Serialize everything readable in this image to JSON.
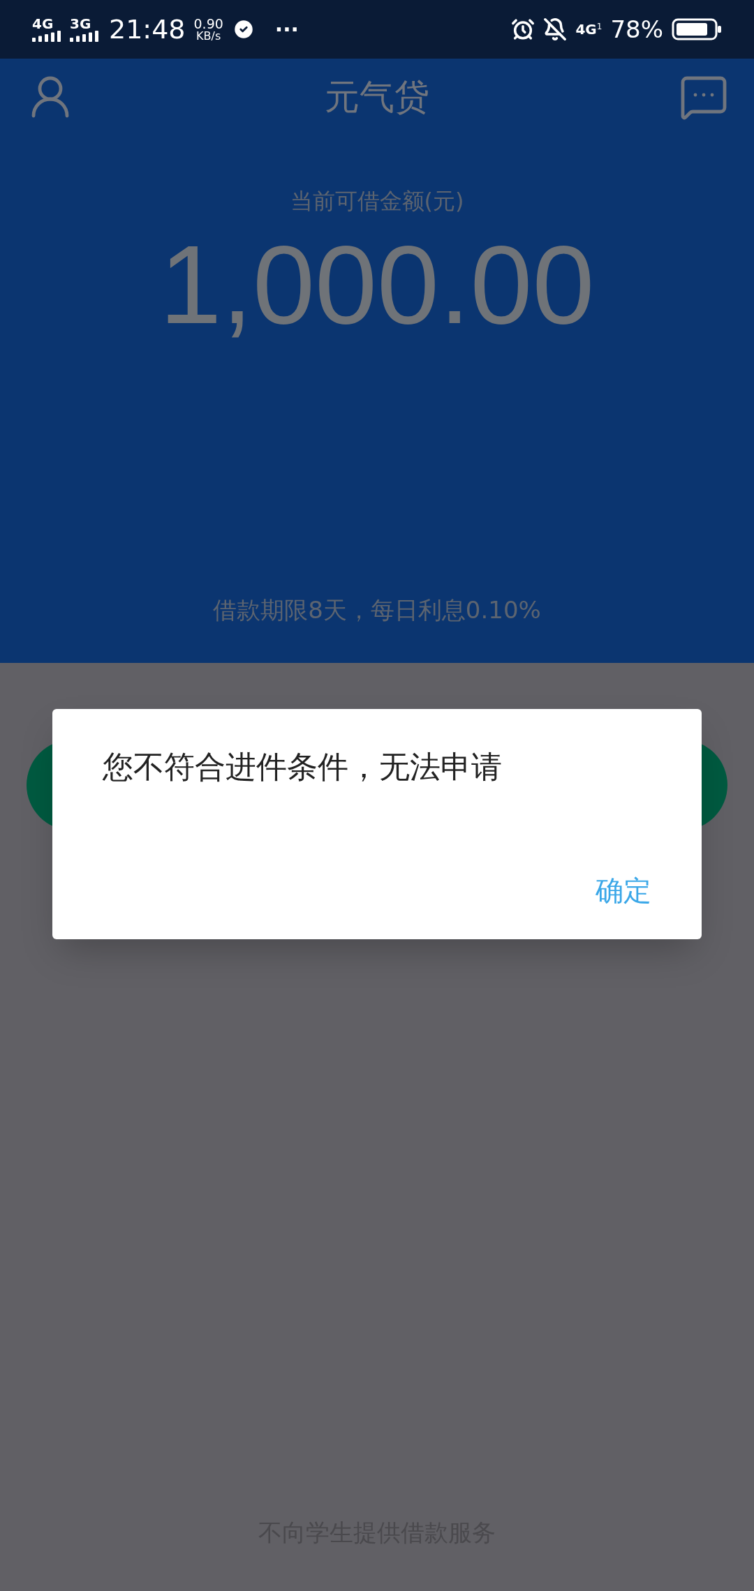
{
  "status_bar": {
    "sim_1": "4G",
    "sim_2": "3G",
    "time": "21:48",
    "speed_value": "0.90",
    "speed_unit": "KB/s",
    "more": "···",
    "network": "4G",
    "network_sub": "1",
    "battery": "78%"
  },
  "header": {
    "title": "元气贷"
  },
  "loan": {
    "label": "当前可借金额(元)",
    "amount": "1,000.00",
    "terms": "借款期限8天，每日利息0.10%"
  },
  "dialog": {
    "message": "您不符合进件条件，无法申请",
    "confirm": "确定"
  },
  "footer": {
    "note": "不向学生提供借款服务"
  }
}
